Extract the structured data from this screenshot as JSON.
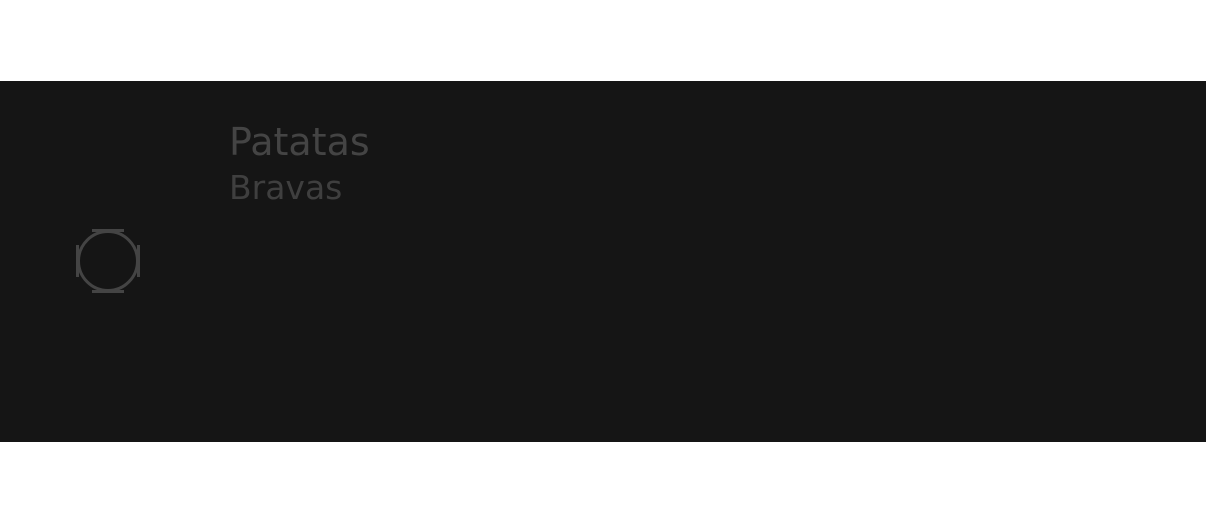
{
  "item": {
    "title": "Patatas",
    "subtitle": "Bravas",
    "selected": false,
    "icon": "radio-unchecked-icon"
  },
  "colors": {
    "panel_background": "#151515",
    "text_primary": "#444444",
    "text_secondary": "#3f3f3f",
    "control": "#444444"
  }
}
